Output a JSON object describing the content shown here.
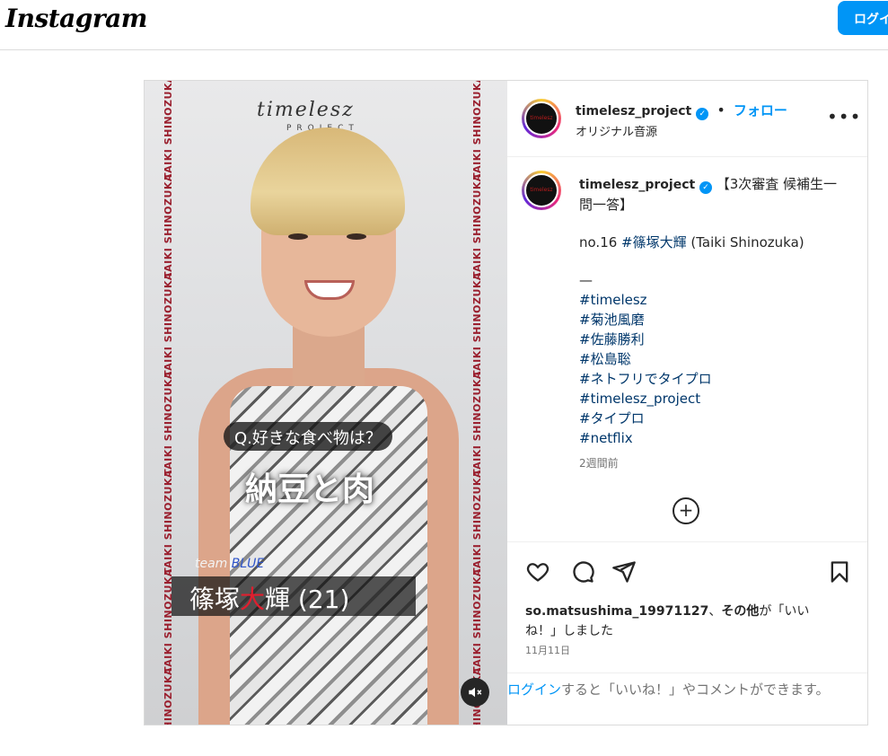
{
  "header": {
    "logo": "Instagram",
    "login_button": "ログイ"
  },
  "media": {
    "brand": "timelesz",
    "brand_sub": "PROJECT",
    "side_text": "TAIKI SHINOZUKA",
    "question": "Q.好きな食べ物は？",
    "answer": "納豆と肉",
    "team_prefix": "team",
    "team_color": "BLUE",
    "name_part1": "篠塚",
    "name_part2": "大",
    "name_part3": "輝 (21)",
    "mute_icon": "speaker-muted"
  },
  "post_header": {
    "username": "timelesz_project",
    "dot": "•",
    "follow": "フォロー",
    "audio": "オリジナル音源",
    "more": "•••"
  },
  "caption": {
    "username": "timelesz_project",
    "title": "【3次審査 候補生一問一答】",
    "line1_prefix": "no.16 ",
    "line1_tag": "#篠塚大輝",
    "line1_suffix": " (Taiki Shinozuka)",
    "dash": "—",
    "hashtags": [
      "#timelesz",
      "#菊池風磨",
      "#佐藤勝利",
      "#松島聡",
      "#ネトフリでタイプロ",
      "#timelesz_project",
      "#タイプロ",
      "#netflix"
    ],
    "time": "2週間前"
  },
  "engagement": {
    "liker": "so.matsushima_19971127",
    "separator": "、",
    "others": "その他",
    "liked_text": "が「いいね！」しました",
    "date": "11月11日"
  },
  "footer": {
    "login_link": "ログイン",
    "message": "すると「いいね！」やコメントができます。"
  },
  "colors": {
    "accent": "#0095f6",
    "hashtag": "#00376b",
    "muted": "#737373"
  }
}
